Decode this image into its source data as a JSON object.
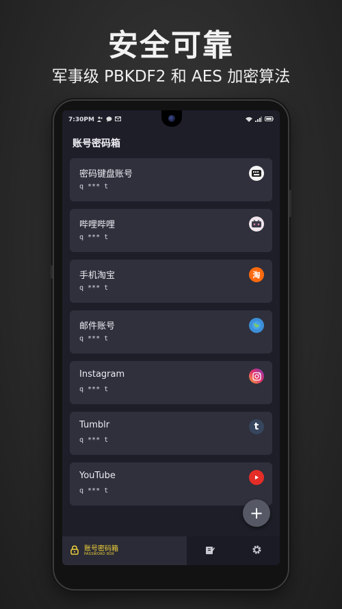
{
  "promo": {
    "title": "安全可靠",
    "subtitle": "军事级 PBKDF2 和 AES 加密算法"
  },
  "status_bar": {
    "time": "7:30PM"
  },
  "app": {
    "title": "账号密码箱"
  },
  "accounts": [
    {
      "name": "密码键盘账号",
      "password": "q *** t",
      "icon": "keyboard-app-icon"
    },
    {
      "name": "哔哩哔哩",
      "password": "q *** t",
      "icon": "bilibili-icon"
    },
    {
      "name": "手机淘宝",
      "password": "q *** t",
      "icon": "taobao-icon",
      "icon_text": "淘"
    },
    {
      "name": "邮件账号",
      "password": "q *** t",
      "icon": "mail-globe-icon"
    },
    {
      "name": "Instagram",
      "password": "q *** t",
      "icon": "instagram-icon"
    },
    {
      "name": "Tumblr",
      "password": "q *** t",
      "icon": "tumblr-icon",
      "icon_text": "t"
    },
    {
      "name": "YouTube",
      "password": "q *** t",
      "icon": "youtube-icon"
    }
  ],
  "fab": {
    "label": "+"
  },
  "bottom_nav": {
    "home_label": "账号密码箱",
    "home_sublabel": "PASSWORD BOX"
  },
  "colors": {
    "accent": "#f2d23a",
    "card": "#2f303c",
    "screen_bg": "#1d1e28"
  }
}
